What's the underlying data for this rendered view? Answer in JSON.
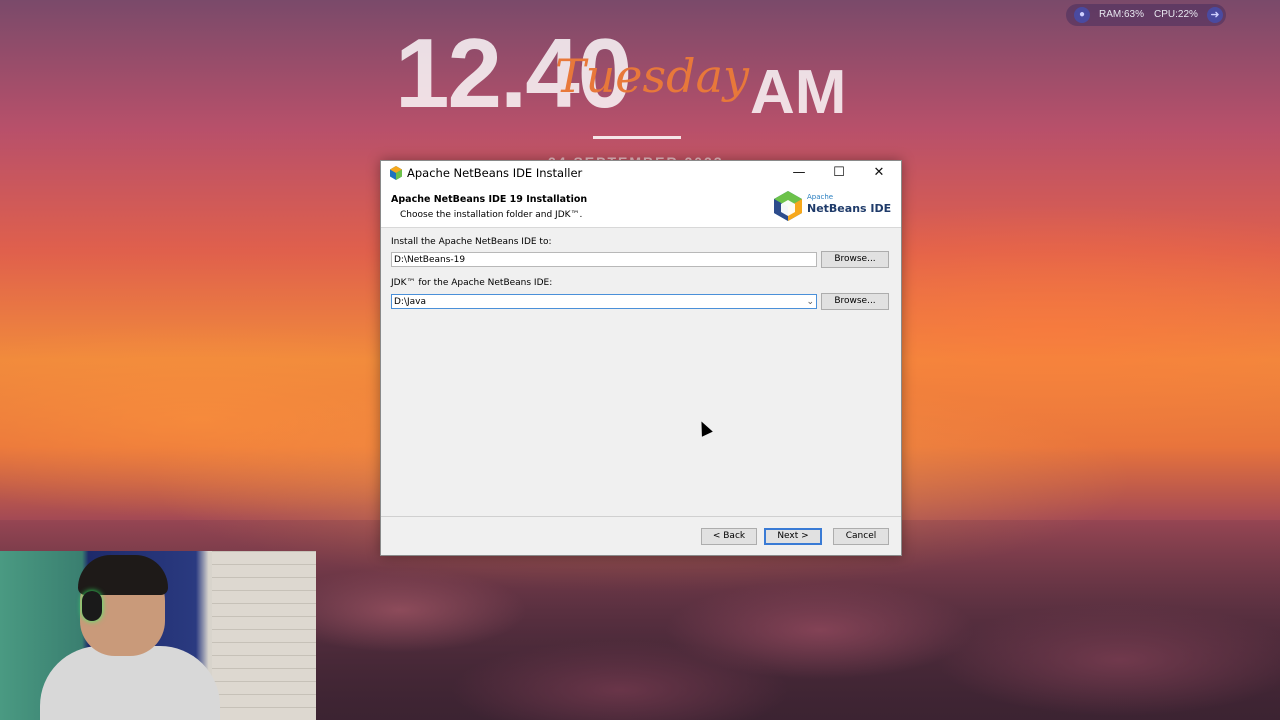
{
  "desktop": {
    "clock_time": "12.40",
    "clock_ampm": "AM",
    "clock_day": "Tuesday",
    "clock_date": "24 SEPTEMBER 2023",
    "ram": "RAM:63%",
    "cpu": "CPU:22%"
  },
  "window": {
    "title": "Apache NetBeans IDE Installer",
    "min": "—",
    "max": "☐",
    "close": "✕"
  },
  "header": {
    "title": "Apache NetBeans IDE 19 Installation",
    "subtitle": "Choose the installation folder and JDK™.",
    "logo_apache": "Apache",
    "logo_name": "NetBeans IDE"
  },
  "form": {
    "install_label": "Install the Apache NetBeans IDE to:",
    "install_value": "D:\\NetBeans-19",
    "jdk_label": "JDK™ for the Apache NetBeans IDE:",
    "jdk_value": "D:\\Java",
    "browse_label": "Browse..."
  },
  "footer": {
    "back": "< Back",
    "next": "Next >",
    "cancel": "Cancel"
  }
}
